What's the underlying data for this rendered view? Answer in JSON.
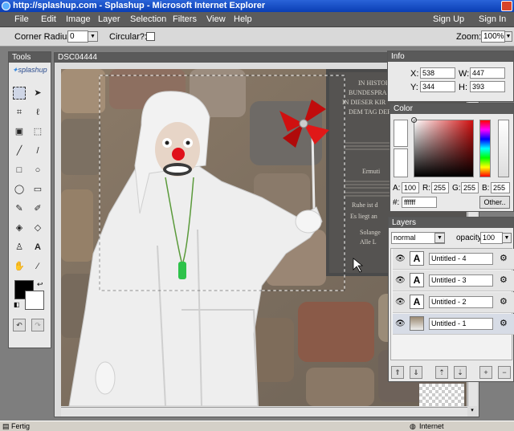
{
  "browser": {
    "title": "http://splashup.com - Splashup - Microsoft Internet Explorer",
    "status_left": "Fertig",
    "status_right": "Internet"
  },
  "menubar": {
    "items": [
      "File",
      "Edit",
      "Image",
      "Layer",
      "Selection",
      "Filters",
      "View",
      "Help"
    ],
    "sign_up": "Sign Up",
    "sign_in": "Sign In"
  },
  "options": {
    "corner_radius_label": "Corner Radius:",
    "corner_radius_value": "0",
    "circular_label": "Circular?:",
    "zoom_label": "Zoom:",
    "zoom_value": "100%"
  },
  "tools": {
    "title": "Tools",
    "logo": "splashup",
    "icons": [
      "marquee-rect-icon",
      "arrow-select-icon",
      "crop-icon",
      "lasso-icon",
      "rect-select-icon",
      "magic-select-icon",
      "pencil-icon",
      "line-icon",
      "rect-icon",
      "ellipse-icon",
      "ellipse-shape-icon",
      "rounded-rect-icon",
      "brush-icon",
      "eraser-brush-icon",
      "bucket-icon",
      "eraser-icon",
      "stamp-icon",
      "text-icon",
      "hand-icon",
      "eyedropper-icon"
    ],
    "text_tool_label": "A",
    "colors": {
      "foreground": "#000000",
      "background": "#ffffff"
    }
  },
  "document": {
    "title": "DSC04444",
    "plaque_lines": [
      "IN HISTOR",
      "BUNDESPRA",
      "IN DIESER KIR",
      "DEM TAG DER"
    ],
    "plaque_lower": [
      "Ermuti",
      "Ruhe ist d",
      "Es liegt an",
      "Solange",
      "Alle L"
    ]
  },
  "info": {
    "title": "Info",
    "x_label": "X:",
    "x_value": "538",
    "y_label": "Y:",
    "y_value": "344",
    "w_label": "W:",
    "w_value": "447",
    "h_label": "H:",
    "h_value": "393"
  },
  "color": {
    "title": "Color",
    "a_label": "A:",
    "a_value": "100",
    "r_label": "R:",
    "r_value": "255",
    "g_label": "G:",
    "g_value": "255",
    "b_label": "B:",
    "b_value": "255",
    "hex_label": "#:",
    "hex_value": "ffffff",
    "other_button": "Other..",
    "accent": "#d01010"
  },
  "layers": {
    "title": "Layers",
    "blend_mode": "normal",
    "opacity_label": "opacity:",
    "opacity_value": "100",
    "items": [
      {
        "name": "Untitled - 4",
        "thumb": "A"
      },
      {
        "name": "Untitled - 3",
        "thumb": "A"
      },
      {
        "name": "Untitled - 2",
        "thumb": "A"
      },
      {
        "name": "Untitled - 1",
        "thumb": ""
      }
    ]
  }
}
